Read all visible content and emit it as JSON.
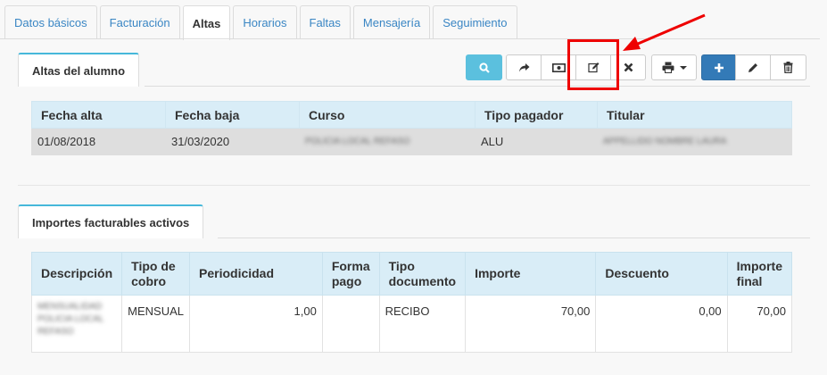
{
  "top_tabs": [
    {
      "label": "Datos básicos",
      "active": false
    },
    {
      "label": "Facturación",
      "active": false
    },
    {
      "label": "Altas",
      "active": true
    },
    {
      "label": "Horarios",
      "active": false
    },
    {
      "label": "Faltas",
      "active": false
    },
    {
      "label": "Mensajería",
      "active": false
    },
    {
      "label": "Seguimiento",
      "active": false
    }
  ],
  "altas": {
    "title": "Altas del alumno",
    "headers": [
      "Fecha alta",
      "Fecha baja",
      "Curso",
      "Tipo pagador",
      "Titular"
    ],
    "rows": [
      {
        "fecha_alta": "01/08/2018",
        "fecha_baja": "31/03/2020",
        "curso": "POLICIA LOCAL REFASO",
        "tipo_pagador": "ALU",
        "titular": "APPELLIDO NOMBRE LAURA"
      }
    ]
  },
  "importes": {
    "title": "Importes facturables activos",
    "headers": {
      "descripcion": "Descripción",
      "tipo_cobro_1": "Tipo de",
      "tipo_cobro_2": "cobro",
      "periodicidad": "Periodicidad",
      "forma_pago_1": "Forma",
      "forma_pago_2": "pago",
      "tipo_doc_1": "Tipo",
      "tipo_doc_2": "documento",
      "importe": "Importe",
      "descuento": "Descuento",
      "importe_final_1": "Importe",
      "importe_final_2": "final"
    },
    "rows": [
      {
        "descripcion": "MENSUALIDAD POLICIA LOCAL REFASO",
        "tipo_cobro": "MENSUAL",
        "periodicidad": "1,00",
        "forma_pago": "",
        "tipo_documento": "RECIBO",
        "importe": "70,00",
        "descuento": "0,00",
        "importe_final": "70,00"
      }
    ]
  },
  "toolbar": {
    "icons": [
      "search-icon",
      "share-icon",
      "money-icon",
      "edit-icon",
      "close-icon",
      "print-icon",
      "plus-icon",
      "pencil-icon",
      "trash-icon"
    ]
  },
  "colors": {
    "accent": "#5bc0de",
    "primary": "#337ab7",
    "table_header": "#d9edf7",
    "annotation": "#e00000",
    "link": "#3a86c4"
  }
}
